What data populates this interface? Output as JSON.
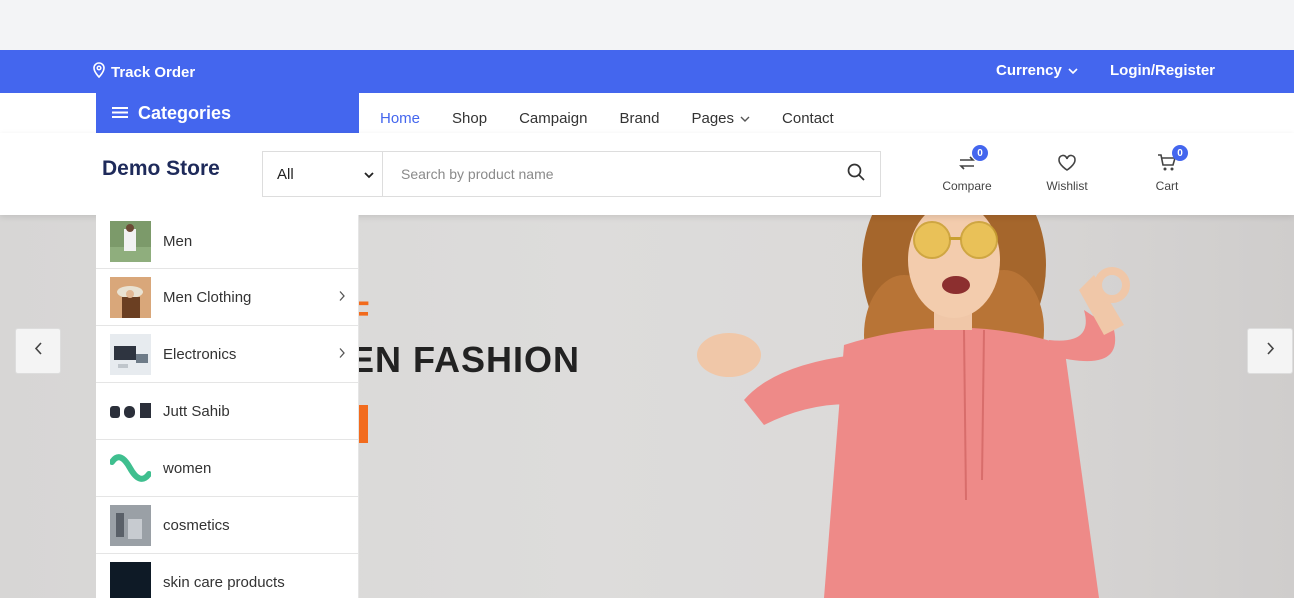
{
  "topbar": {
    "track_order": "Track Order",
    "currency": "Currency",
    "login": "Login/Register"
  },
  "nav": {
    "categories_label": "Categories",
    "links": [
      "Home",
      "Shop",
      "Campaign",
      "Brand",
      "Pages",
      "Contact"
    ]
  },
  "header": {
    "logo_text": "Demo Store",
    "search_category": "All",
    "search_placeholder": "Search by product name",
    "compare_label": "Compare",
    "compare_count": "0",
    "wishlist_label": "Wishlist",
    "cart_label": "Cart",
    "cart_count": "0"
  },
  "categories": [
    {
      "label": "Men",
      "has_sub": false
    },
    {
      "label": "Men Clothing",
      "has_sub": true
    },
    {
      "label": "Electronics",
      "has_sub": true
    },
    {
      "label": "Jutt Sahib",
      "has_sub": false
    },
    {
      "label": "women",
      "has_sub": false
    },
    {
      "label": "cosmetics",
      "has_sub": false
    },
    {
      "label": "skin care products",
      "has_sub": false
    }
  ],
  "hero": {
    "line1": "F",
    "line2": "EN FASHION"
  },
  "colors": {
    "primary": "#4466ee",
    "accent": "#f26b1d",
    "hoodie": "#ee8a88"
  }
}
